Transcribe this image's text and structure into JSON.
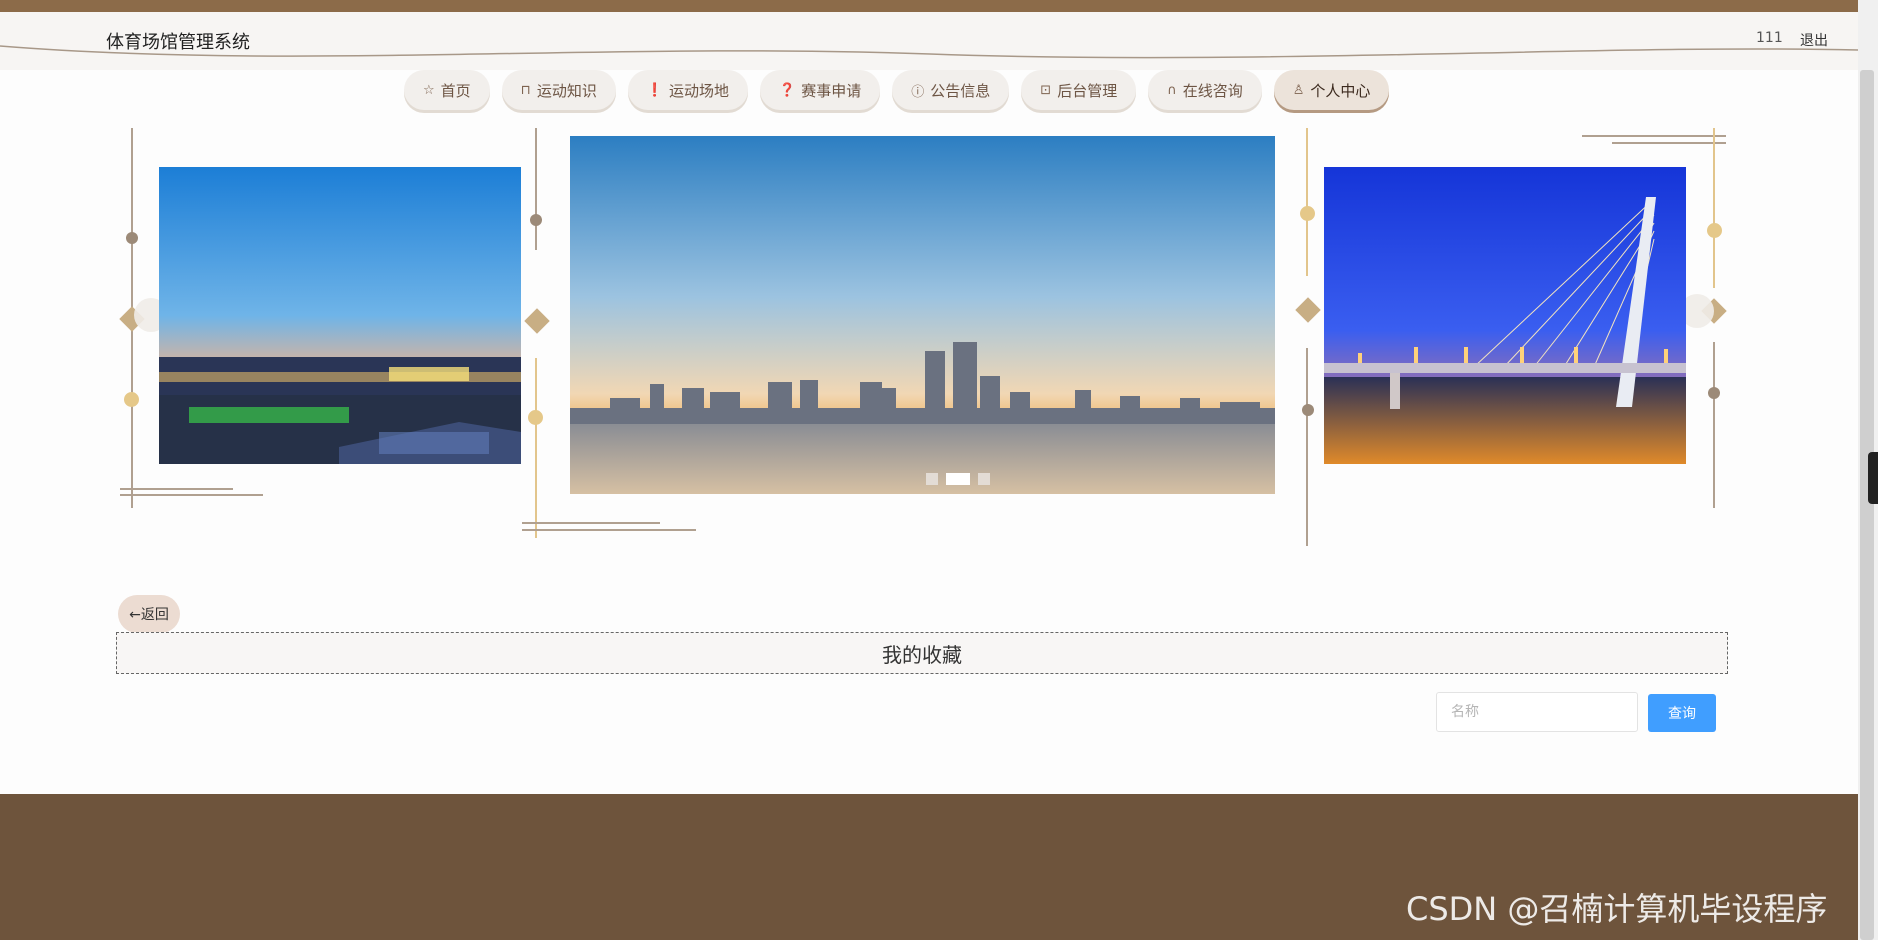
{
  "header": {
    "site_title": "体育场馆管理系统",
    "user": "111",
    "logout": "退出"
  },
  "nav": {
    "items": [
      {
        "icon": "star-icon",
        "label": "首页"
      },
      {
        "icon": "bag-icon",
        "label": "运动知识"
      },
      {
        "icon": "alert-circle-icon",
        "label": "运动场地"
      },
      {
        "icon": "question-circle-icon",
        "label": "赛事申请"
      },
      {
        "icon": "info-circle-icon",
        "label": "公告信息"
      },
      {
        "icon": "box-icon",
        "label": "后台管理"
      },
      {
        "icon": "headset-icon",
        "label": "在线咨询"
      },
      {
        "icon": "user-icon",
        "label": "个人中心"
      }
    ],
    "active_index": 7
  },
  "carousel": {
    "slides": [
      "city-waterfront-stadium-night",
      "city-skyline-river-dusk",
      "cable-stayed-bridge-night"
    ],
    "active_index": 1
  },
  "page": {
    "back_label": "←返回",
    "title": "我的收藏"
  },
  "search": {
    "placeholder": "名称",
    "button_label": "查询"
  },
  "watermark": "CSDN @召楠计算机毕设程序",
  "colors": {
    "brand_brown": "#6e543c",
    "accent_gold": "#e2c58c",
    "primary_button": "#409eff"
  }
}
